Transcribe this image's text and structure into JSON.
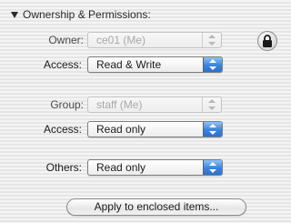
{
  "section": {
    "title": "Ownership & Permissions:"
  },
  "owner": {
    "label": "Owner:",
    "value": "ce01 (Me)"
  },
  "owner_access": {
    "label": "Access:",
    "value": "Read & Write"
  },
  "group": {
    "label": "Group:",
    "value": "staff (Me)"
  },
  "group_access": {
    "label": "Access:",
    "value": "Read only"
  },
  "others": {
    "label": "Others:",
    "value": "Read only"
  },
  "apply_button": {
    "label": "Apply to enclosed items..."
  },
  "icons": {
    "disclosure": "disclosure-triangle-icon",
    "lock": "lock-icon",
    "popup_arrows": "up-down-arrows-icon"
  },
  "colors": {
    "popup_accent": "#3a82de",
    "disabled_text": "#a8a8a8"
  }
}
